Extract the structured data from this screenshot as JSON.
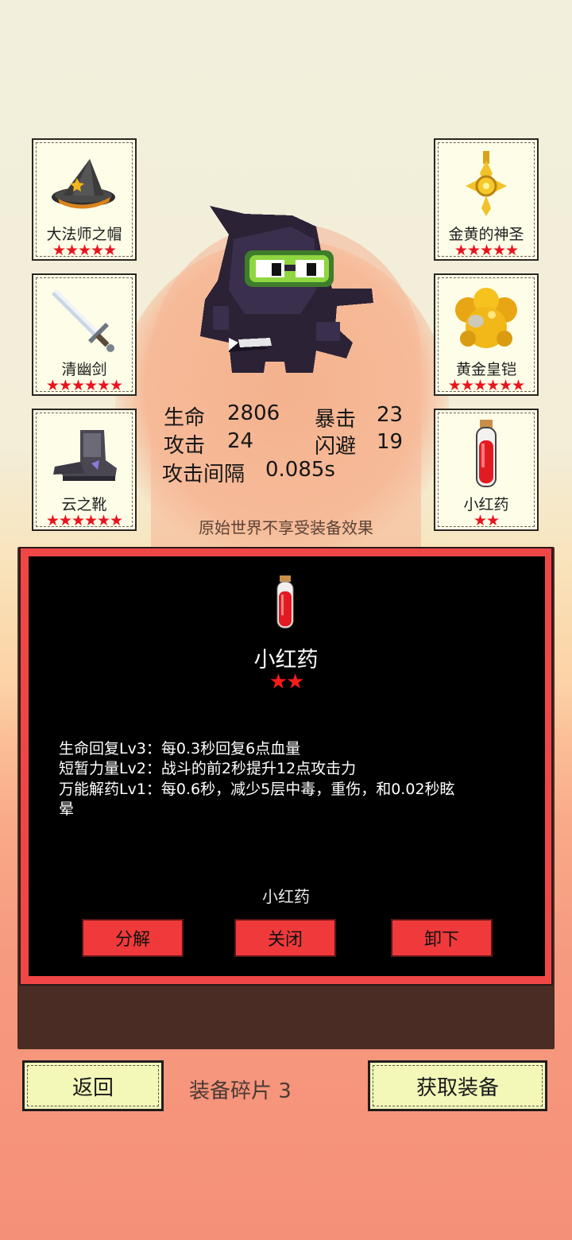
{
  "equipment": {
    "left": [
      {
        "name": "大法师之帽",
        "stars": "★★★★★",
        "icon": "wizard-hat-icon"
      },
      {
        "name": "清幽剑",
        "stars": "★★★★★★",
        "icon": "sword-icon"
      },
      {
        "name": "云之靴",
        "stars": "★★★★★★",
        "icon": "boots-icon"
      }
    ],
    "right": [
      {
        "name": "金黄的神圣",
        "stars": "★★★★★",
        "icon": "holy-amulet-icon"
      },
      {
        "name": "黄金皇铠",
        "stars": "★★★★★★",
        "icon": "gold-armor-icon"
      },
      {
        "name": "小红药",
        "stars": "★★",
        "icon": "red-potion-icon"
      }
    ]
  },
  "stats": {
    "hp_label": "生命",
    "hp_value": "2806",
    "crit_label": "暴击",
    "crit_value": "23",
    "atk_label": "攻击",
    "atk_value": "24",
    "dodge_label": "闪避",
    "dodge_value": "19",
    "interval_label": "攻击间隔",
    "interval_value": "0.085s"
  },
  "note": "原始世界不享受装备效果",
  "detail": {
    "icon": "red-potion-icon",
    "title": "小红药",
    "stars": "★★",
    "effects": [
      "生命回复Lv3：每0.3秒回复6点血量",
      "短暂力量Lv2：战斗的前2秒提升12点攻击力",
      "万能解药Lv1：每0.6秒，减少5层中毒，重伤，和0.02秒眩",
      "晕"
    ],
    "subtitle": "小红药",
    "buttons": {
      "decompose": "分解",
      "close": "关闭",
      "unequip": "卸下"
    }
  },
  "bottom": {
    "back_label": "返回",
    "shards_label": "装备碎片 3",
    "get_label": "获取装备"
  },
  "colors": {
    "accent_red": "#f0393b",
    "star_red": "#e8141e",
    "button_yellow": "#f3f7b8"
  }
}
